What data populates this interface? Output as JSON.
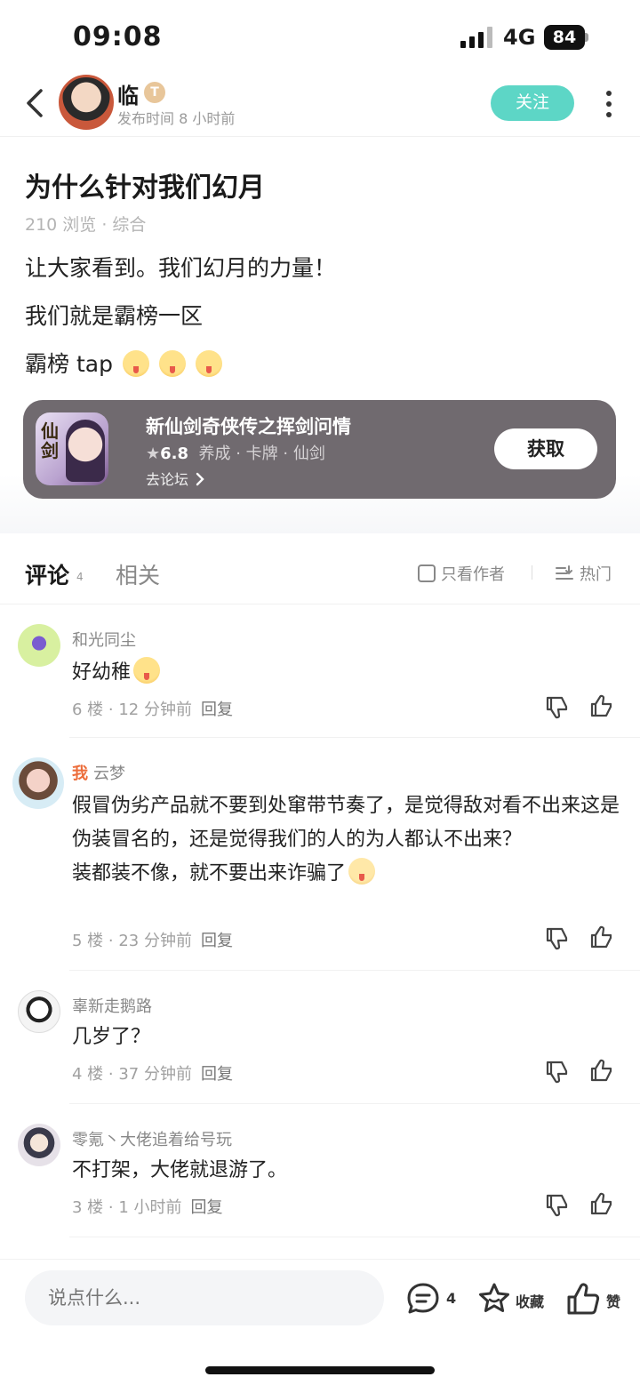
{
  "status": {
    "time": "09:08",
    "network": "4G",
    "battery": "84"
  },
  "header": {
    "author": "临",
    "level_badge": "T",
    "post_time": "发布时间 8 小时前",
    "follow_label": "关注"
  },
  "post": {
    "title": "为什么针对我们幻月",
    "meta": "210 浏览 · 综合",
    "lines": [
      "让大家看到。我们幻月的力量！",
      "我们就是霸榜一区",
      "霸榜 tap"
    ]
  },
  "game": {
    "name": "新仙剑奇侠传之挥剑问情",
    "rating": "6.8",
    "tags": "养成 · 卡牌 · 仙剑",
    "forum_label": "去论坛",
    "get_label": "获取",
    "icon_text": "仙剑"
  },
  "tabs": {
    "comments_label": "评论",
    "comments_count": "4",
    "related_label": "相关",
    "only_author_label": "只看作者",
    "sort_label": "热门"
  },
  "comments": [
    {
      "name": "和光同尘",
      "text": "好幼稚",
      "floor": "6 楼 · 12 分钟前",
      "reply": "回复"
    },
    {
      "me": "我",
      "name": "云梦",
      "text": "假冒伪劣产品就不要到处窜带节奏了，是觉得敌对看不出来这是伪装冒名的，还是觉得我们的人的为人都认不出来？",
      "text2": "装都装不像，就不要出来诈骗了",
      "floor": "5 楼 · 23 分钟前",
      "reply": "回复"
    },
    {
      "name": "辜新走鹅路",
      "text": "几岁了？",
      "floor": "4 楼 · 37 分钟前",
      "reply": "回复"
    },
    {
      "name": "零氪丶大佬追着给号玩",
      "text": "不打架，大佬就退游了。",
      "floor": "3 楼 · 1 小时前",
      "reply": "回复"
    }
  ],
  "bottom": {
    "input_placeholder": "说点什么...",
    "comment_count": "4",
    "favorite_label": "收藏",
    "like_label": "赞"
  },
  "colors": {
    "accent": "#5dd6c6",
    "me": "#ec6d3b",
    "card": "#706a6f"
  }
}
